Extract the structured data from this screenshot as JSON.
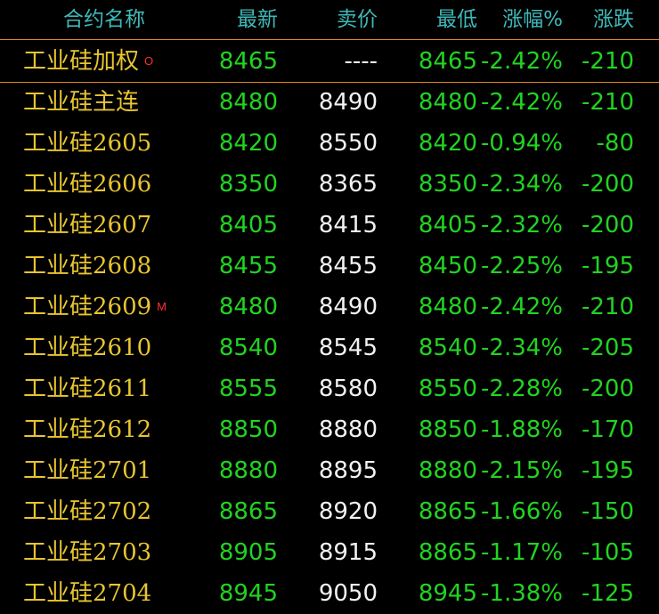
{
  "header": {
    "name": "合约名称",
    "last": "最新",
    "ask": "卖价",
    "low": "最低",
    "pct": "涨幅%",
    "chg": "涨跌"
  },
  "rows": [
    {
      "name": "工业硅加权",
      "mark": "O",
      "last": "8465",
      "ask": "----",
      "low": "8465",
      "pct": "-2.42%",
      "chg": "-210"
    },
    {
      "name": "工业硅主连",
      "mark": "",
      "last": "8480",
      "ask": "8490",
      "low": "8480",
      "pct": "-2.42%",
      "chg": "-210"
    },
    {
      "name": "工业硅2605",
      "mark": "",
      "last": "8420",
      "ask": "8550",
      "low": "8420",
      "pct": "-0.94%",
      "chg": "-80"
    },
    {
      "name": "工业硅2606",
      "mark": "",
      "last": "8350",
      "ask": "8365",
      "low": "8350",
      "pct": "-2.34%",
      "chg": "-200"
    },
    {
      "name": "工业硅2607",
      "mark": "",
      "last": "8405",
      "ask": "8415",
      "low": "8405",
      "pct": "-2.32%",
      "chg": "-200"
    },
    {
      "name": "工业硅2608",
      "mark": "",
      "last": "8455",
      "ask": "8455",
      "low": "8450",
      "pct": "-2.25%",
      "chg": "-195"
    },
    {
      "name": "工业硅2609",
      "mark": "M",
      "last": "8480",
      "ask": "8490",
      "low": "8480",
      "pct": "-2.42%",
      "chg": "-210"
    },
    {
      "name": "工业硅2610",
      "mark": "",
      "last": "8540",
      "ask": "8545",
      "low": "8540",
      "pct": "-2.34%",
      "chg": "-205"
    },
    {
      "name": "工业硅2611",
      "mark": "",
      "last": "8555",
      "ask": "8580",
      "low": "8550",
      "pct": "-2.28%",
      "chg": "-200"
    },
    {
      "name": "工业硅2612",
      "mark": "",
      "last": "8850",
      "ask": "8880",
      "low": "8850",
      "pct": "-1.88%",
      "chg": "-170"
    },
    {
      "name": "工业硅2701",
      "mark": "",
      "last": "8880",
      "ask": "8895",
      "low": "8880",
      "pct": "-2.15%",
      "chg": "-195"
    },
    {
      "name": "工业硅2702",
      "mark": "",
      "last": "8865",
      "ask": "8920",
      "low": "8865",
      "pct": "-1.66%",
      "chg": "-150"
    },
    {
      "name": "工业硅2703",
      "mark": "",
      "last": "8905",
      "ask": "8915",
      "low": "8865",
      "pct": "-1.17%",
      "chg": "-105"
    },
    {
      "name": "工业硅2704",
      "mark": "",
      "last": "8945",
      "ask": "9050",
      "low": "8945",
      "pct": "-1.38%",
      "chg": "-125"
    }
  ],
  "colors": {
    "background": "#000000",
    "header_text": "#3fb8b8",
    "name_text": "#e8c530",
    "down_green": "#22d322",
    "ask_white": "#f2f2f2",
    "separator": "#e08a1e",
    "marker_red": "#ff3030"
  }
}
